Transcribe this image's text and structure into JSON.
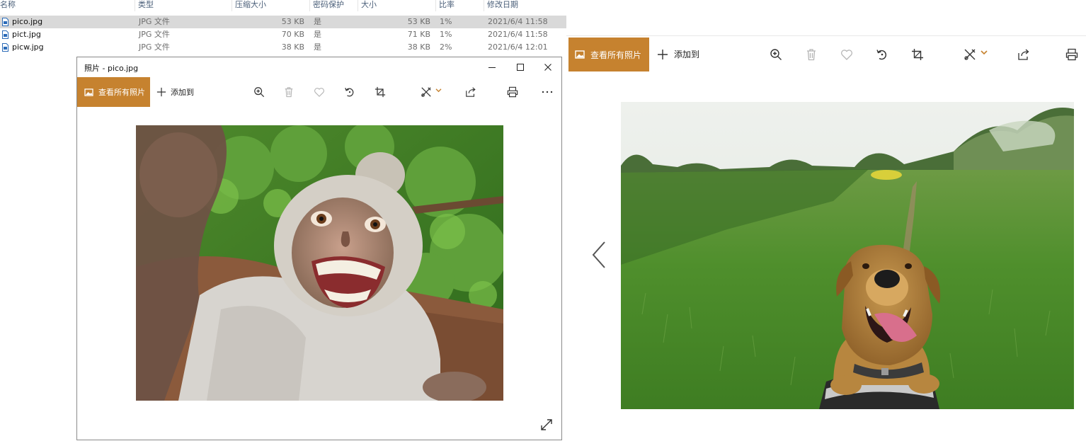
{
  "explorer": {
    "columns": {
      "name": "名称",
      "type": "类型",
      "compressed_size": "压缩大小",
      "password": "密码保护",
      "size": "大小",
      "ratio": "比率",
      "modified": "修改日期"
    },
    "files": [
      {
        "name": "pico.jpg",
        "type": "JPG 文件",
        "compressed_size": "53 KB",
        "password": "是",
        "size": "53 KB",
        "ratio": "1%",
        "modified": "2021/6/4 11:58",
        "selected": true
      },
      {
        "name": "pict.jpg",
        "type": "JPG 文件",
        "compressed_size": "70 KB",
        "password": "是",
        "size": "71 KB",
        "ratio": "1%",
        "modified": "2021/6/4 11:58",
        "selected": false
      },
      {
        "name": "picw.jpg",
        "type": "JPG 文件",
        "compressed_size": "38 KB",
        "password": "是",
        "size": "38 KB",
        "ratio": "2%",
        "modified": "2021/6/4 12:01",
        "selected": false
      }
    ]
  },
  "small_window": {
    "title": "照片 - pico.jpg",
    "view_all_label": "查看所有照片",
    "add_to_label": "添加到",
    "photo_subject": "monkey-selfie"
  },
  "large_view": {
    "view_all_label": "查看所有照片",
    "add_to_label": "添加到",
    "photo_subject": "dog-selfie"
  },
  "colors": {
    "accent": "#c6822f",
    "selection": "#d9d9d9",
    "toolbar_icon": "#333333",
    "disabled_icon": "#b5b5b5"
  }
}
